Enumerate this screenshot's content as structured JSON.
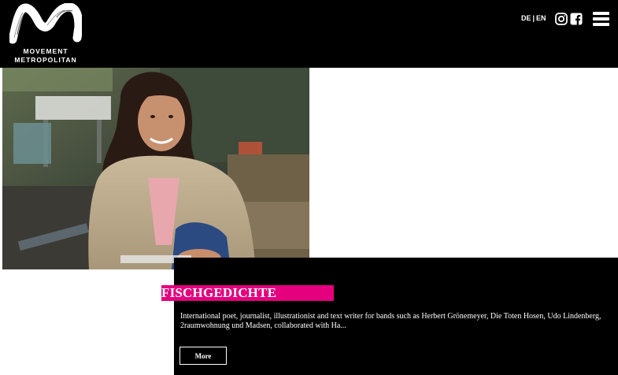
{
  "header": {
    "logo_line1": "MOVEMENT",
    "logo_line2": "METROPOLITAN",
    "languages": [
      "DE",
      "EN"
    ],
    "social_icons": [
      "instagram-icon",
      "facebook-icon"
    ],
    "menu_icon": "hamburger-menu-icon"
  },
  "feature": {
    "title": "FISCHGEDICHTE",
    "description": "International poet, journalist, illustrationist and text writer for bands such as Herbert Grönemeyer, Die Toten Hosen, Udo Lindenberg, 2raumwohnung und Madsen, collaborated with Ha...",
    "more_label": "More",
    "accent_color": "#e5007e"
  }
}
